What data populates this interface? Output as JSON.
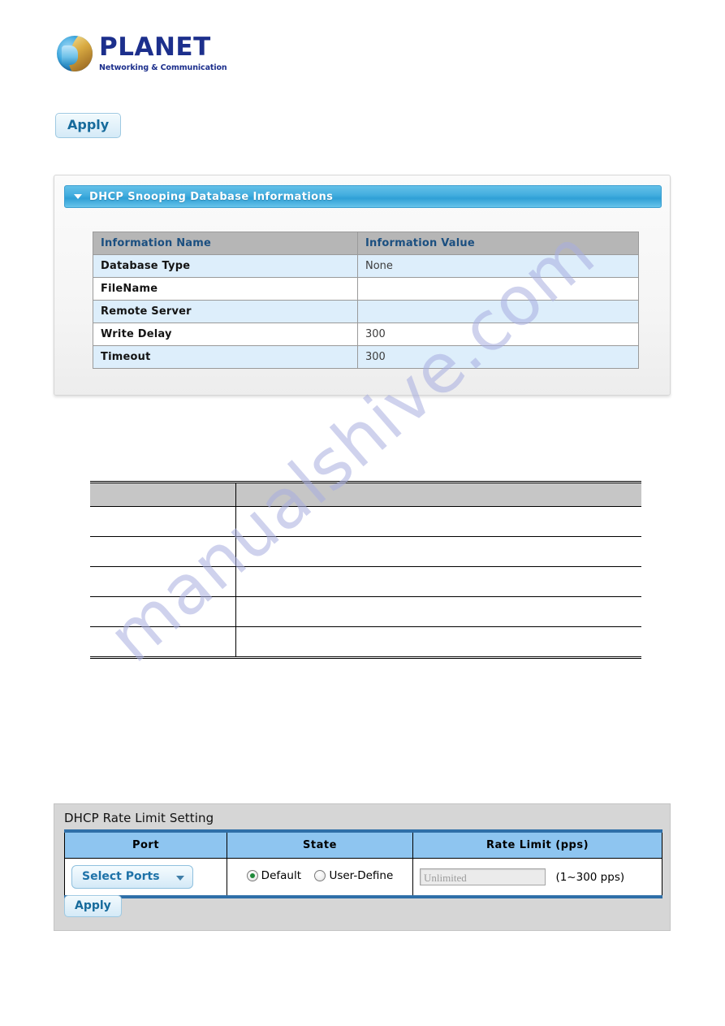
{
  "brand": {
    "name": "PLANET",
    "tagline": "Networking & Communication",
    "logo_icon": "globe-icon",
    "name_color": "#1c2f8c"
  },
  "watermark": {
    "text": "manualshive.com",
    "color": "#a8aee0"
  },
  "buttons": {
    "apply_top": "Apply",
    "apply_bottom": "Apply"
  },
  "db_panel": {
    "title": "DHCP Snooping Database Informations",
    "collapse_icon": "chevron-down-icon",
    "header_color": "#44aedf",
    "table": {
      "columns": [
        "Information Name",
        "Information Value"
      ],
      "rows": [
        {
          "name": "Database Type",
          "value": "None"
        },
        {
          "name": "FileName",
          "value": ""
        },
        {
          "name": "Remote Server",
          "value": ""
        },
        {
          "name": "Write Delay",
          "value": "300"
        },
        {
          "name": "Timeout",
          "value": "300"
        }
      ]
    }
  },
  "desc_table": {
    "columns": [
      "",
      ""
    ],
    "rows": [
      {
        "c1": "",
        "c2": ""
      },
      {
        "c1": "",
        "c2": ""
      },
      {
        "c1": "",
        "c2": ""
      },
      {
        "c1": "",
        "c2": ""
      },
      {
        "c1": "",
        "c2": ""
      }
    ]
  },
  "rate_panel": {
    "title": "DHCP Rate Limit Setting",
    "columns": [
      "Port",
      "State",
      "Rate Limit (pps)"
    ],
    "port_select_label": "Select Ports",
    "port_select_icon": "chevron-down-icon",
    "state_options": [
      {
        "label": "Default",
        "checked": true
      },
      {
        "label": "User-Define",
        "checked": false
      }
    ],
    "rate_input_placeholder": "Unlimited",
    "rate_input_value": "",
    "rate_range_hint": "(1~300 pps)",
    "header_color": "#8ec5f0",
    "border_color": "#2f6fa8"
  }
}
